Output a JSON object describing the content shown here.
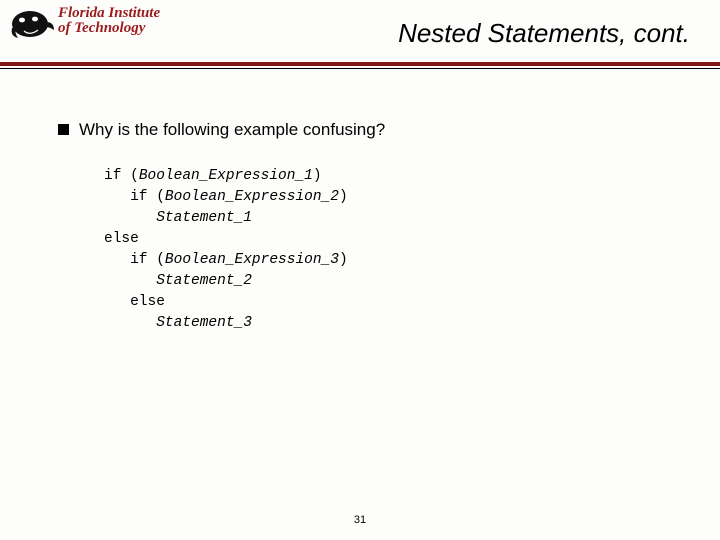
{
  "logo": {
    "line1": "Florida Institute",
    "line2": "of Technology"
  },
  "title": "Nested Statements, cont.",
  "bullet": "Why is the following example confusing?",
  "code": {
    "l1a": "if (",
    "l1b": "Boolean_Expression_1",
    "l1c": ")",
    "l2a": "   if (",
    "l2b": "Boolean_Expression_2",
    "l2c": ")",
    "l3a": "      ",
    "l3b": "Statement_1",
    "l4": "else",
    "l5a": "   if (",
    "l5b": "Boolean_Expression_3",
    "l5c": ")",
    "l6a": "      ",
    "l6b": "Statement_2",
    "l7": "   else",
    "l8a": "      ",
    "l8b": "Statement_3"
  },
  "page": "31"
}
